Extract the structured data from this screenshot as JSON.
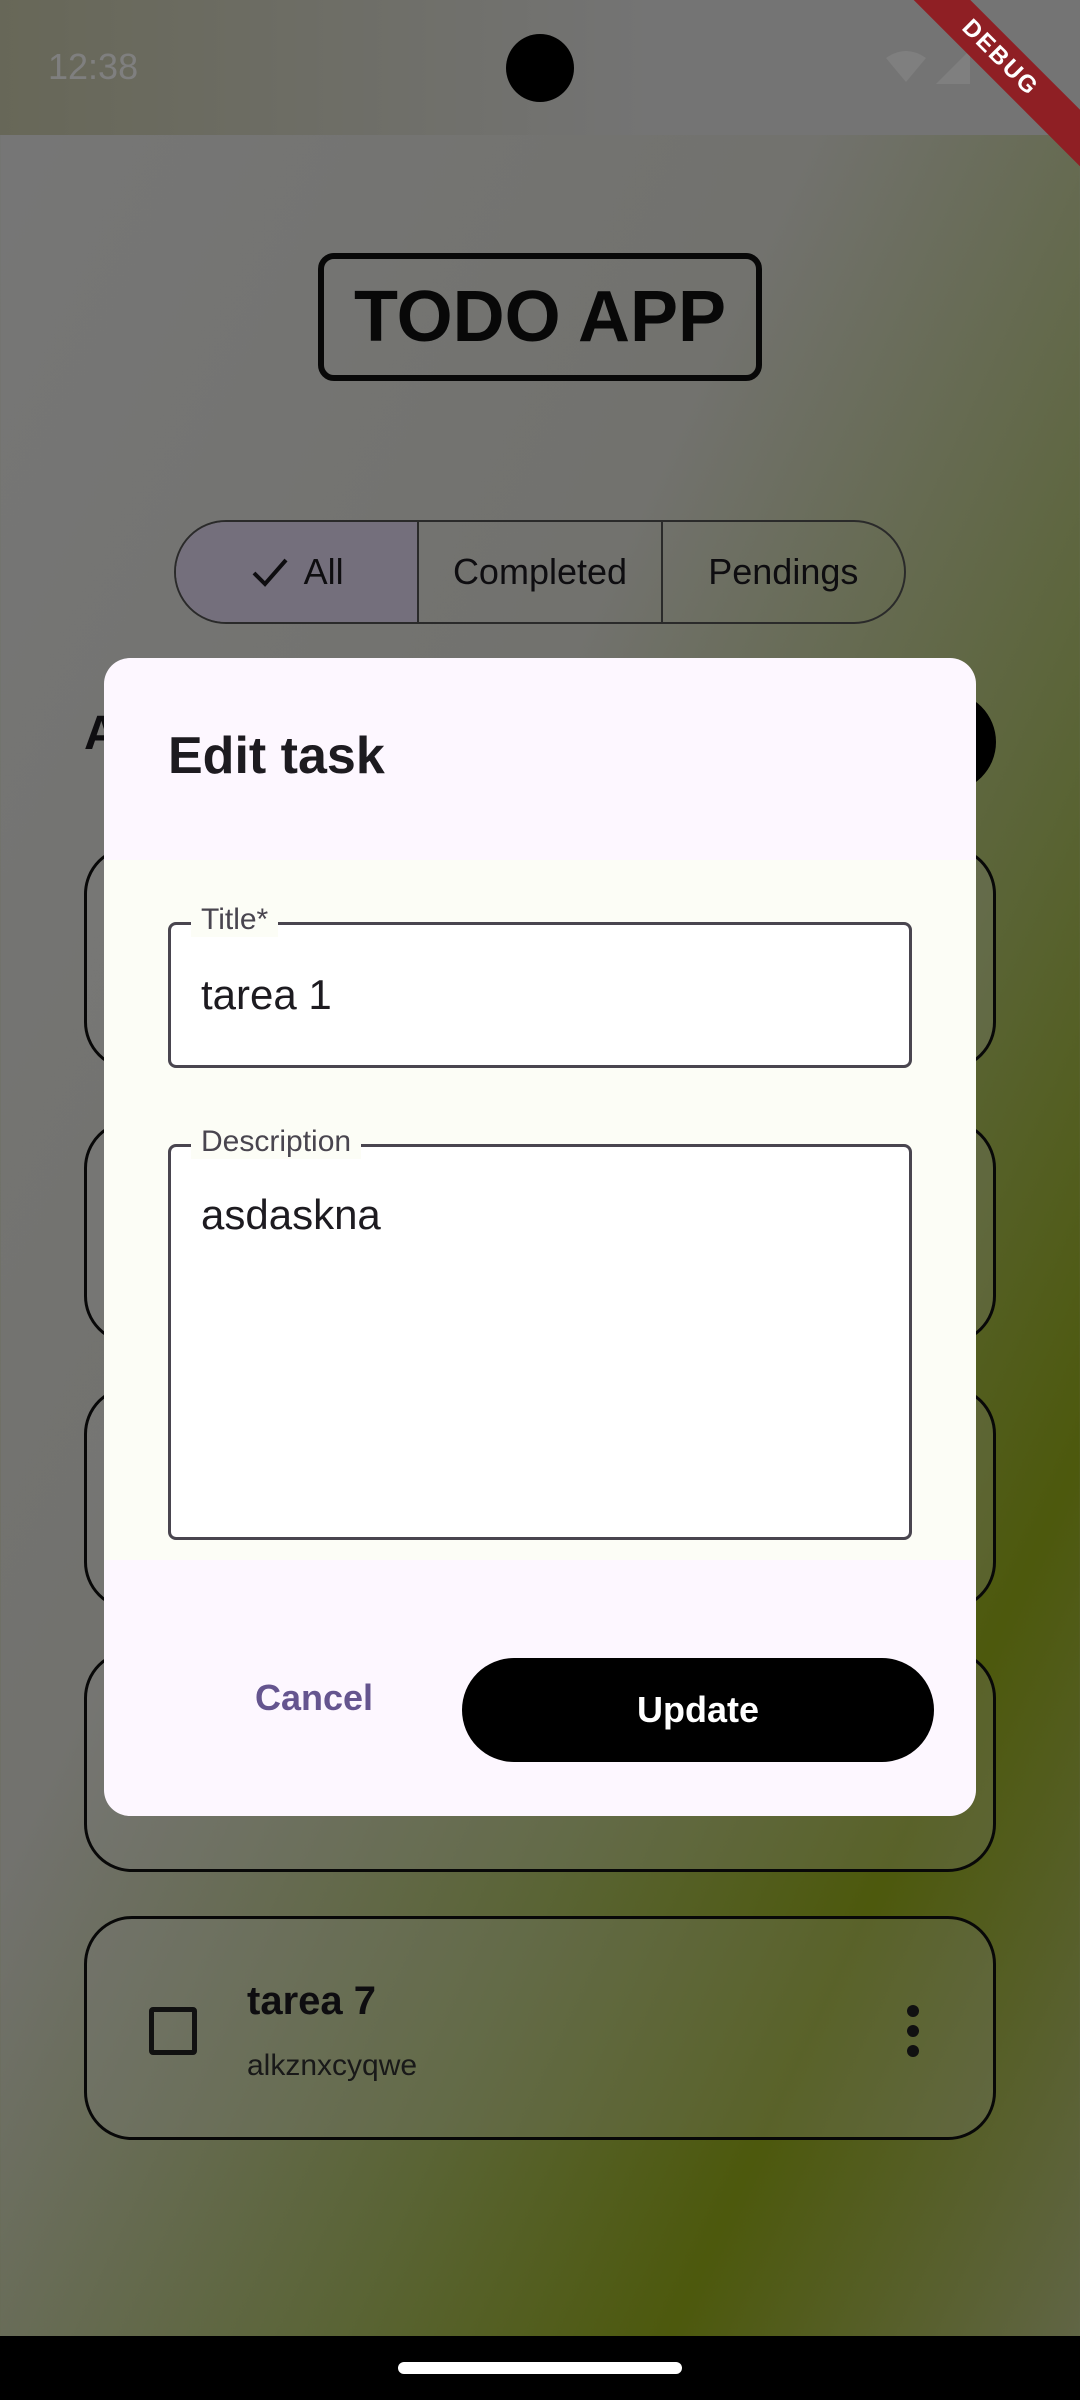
{
  "status_bar": {
    "time": "12:38",
    "icons": [
      "wifi-icon",
      "signal-icon"
    ],
    "debug_label": "DEBUG"
  },
  "app": {
    "title": "TODO APP",
    "filters": [
      {
        "label": "All",
        "selected": true,
        "icon": "check-icon"
      },
      {
        "label": "Completed",
        "selected": false
      },
      {
        "label": "Pendings",
        "selected": false
      }
    ],
    "list_header": "A",
    "tasks": [
      {
        "title": "tarea 7",
        "description": "alkznxcyqwe",
        "completed": false
      }
    ]
  },
  "dialog": {
    "title": "Edit task",
    "title_field": {
      "label": "Title*",
      "value": "tarea 1"
    },
    "description_field": {
      "label": "Description",
      "value": "asdaskna"
    },
    "cancel_label": "Cancel",
    "update_label": "Update"
  },
  "colors": {
    "primary": "#000000",
    "secondary_text": "#65558f",
    "dialog_bg": "#fdf7ff",
    "debug_banner": "#8f1f24",
    "selected_segment": "#e8def8"
  }
}
